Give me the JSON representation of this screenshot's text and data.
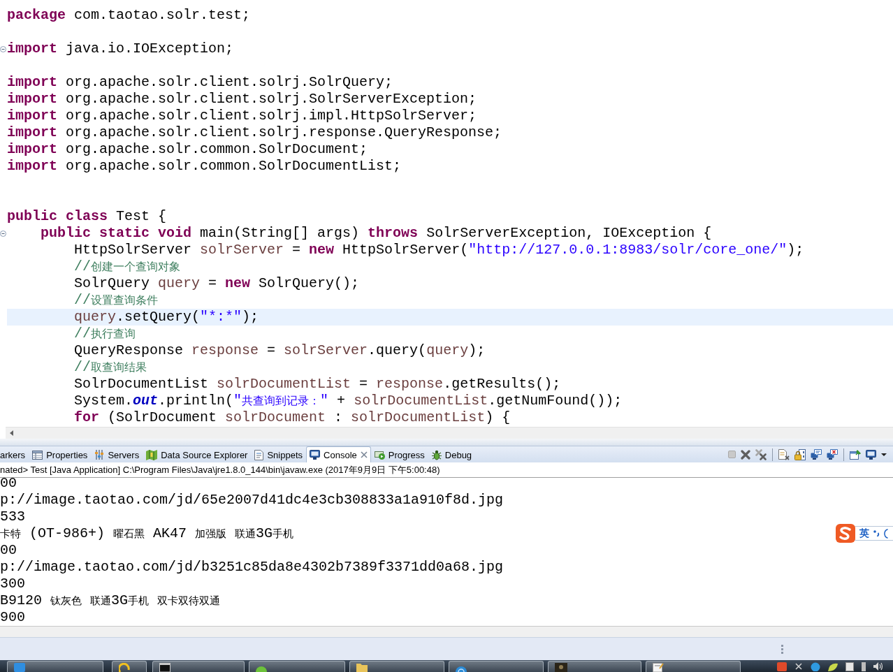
{
  "editor": {
    "lines": [
      {
        "kind": "code",
        "highlighted": false,
        "collapsible": false,
        "tokens": [
          {
            "kind": "keyword",
            "text": "package"
          },
          {
            "kind": "plain",
            "text": " com.taotao.solr.test;"
          }
        ]
      },
      {
        "kind": "blank"
      },
      {
        "kind": "code",
        "highlighted": false,
        "collapsible": true,
        "tokens": [
          {
            "kind": "keyword",
            "text": "import"
          },
          {
            "kind": "plain",
            "text": " java.io.IOException;"
          }
        ]
      },
      {
        "kind": "blank"
      },
      {
        "kind": "code",
        "highlighted": false,
        "collapsible": false,
        "tokens": [
          {
            "kind": "keyword",
            "text": "import"
          },
          {
            "kind": "plain",
            "text": " org.apache.solr.client.solrj.SolrQuery;"
          }
        ]
      },
      {
        "kind": "code",
        "highlighted": false,
        "collapsible": false,
        "tokens": [
          {
            "kind": "keyword",
            "text": "import"
          },
          {
            "kind": "plain",
            "text": " org.apache.solr.client.solrj.SolrServerException;"
          }
        ]
      },
      {
        "kind": "code",
        "highlighted": false,
        "collapsible": false,
        "tokens": [
          {
            "kind": "keyword",
            "text": "import"
          },
          {
            "kind": "plain",
            "text": " org.apache.solr.client.solrj.impl.HttpSolrServer;"
          }
        ]
      },
      {
        "kind": "code",
        "highlighted": false,
        "collapsible": false,
        "tokens": [
          {
            "kind": "keyword",
            "text": "import"
          },
          {
            "kind": "plain",
            "text": " org.apache.solr.client.solrj.response.QueryResponse;"
          }
        ]
      },
      {
        "kind": "code",
        "highlighted": false,
        "collapsible": false,
        "tokens": [
          {
            "kind": "keyword",
            "text": "import"
          },
          {
            "kind": "plain",
            "text": " org.apache.solr.common.SolrDocument;"
          }
        ]
      },
      {
        "kind": "code",
        "highlighted": false,
        "collapsible": false,
        "tokens": [
          {
            "kind": "keyword",
            "text": "import"
          },
          {
            "kind": "plain",
            "text": " org.apache.solr.common.SolrDocumentList;"
          }
        ]
      },
      {
        "kind": "blank"
      },
      {
        "kind": "blank"
      },
      {
        "kind": "code",
        "highlighted": false,
        "collapsible": false,
        "tokens": [
          {
            "kind": "keyword",
            "text": "public"
          },
          {
            "kind": "keyword",
            "text": " class"
          },
          {
            "kind": "plain",
            "text": " Test {"
          }
        ]
      },
      {
        "kind": "code",
        "highlighted": false,
        "collapsible": true,
        "tokens": [
          {
            "kind": "keyword",
            "text": "    public"
          },
          {
            "kind": "keyword",
            "text": " static"
          },
          {
            "kind": "keyword",
            "text": " void"
          },
          {
            "kind": "plain",
            "text": " main(String[] args) "
          },
          {
            "kind": "keyword",
            "text": "throws"
          },
          {
            "kind": "plain",
            "text": " SolrServerException, IOException {"
          }
        ]
      },
      {
        "kind": "code",
        "highlighted": false,
        "collapsible": false,
        "tokens": [
          {
            "kind": "plain",
            "text": "        HttpSolrServer "
          },
          {
            "kind": "variable",
            "text": "solrServer"
          },
          {
            "kind": "plain",
            "text": " = "
          },
          {
            "kind": "keyword",
            "text": "new"
          },
          {
            "kind": "plain",
            "text": " HttpSolrServer("
          },
          {
            "kind": "string",
            "text": "\"http://127.0.0.1:8983/solr/core_one/\""
          },
          {
            "kind": "plain",
            "text": ");"
          }
        ]
      },
      {
        "kind": "code",
        "highlighted": false,
        "collapsible": false,
        "tokens": [
          {
            "kind": "comment",
            "text": "        //创建一个查询对象"
          }
        ]
      },
      {
        "kind": "code",
        "highlighted": false,
        "collapsible": false,
        "tokens": [
          {
            "kind": "plain",
            "text": "        SolrQuery "
          },
          {
            "kind": "variable",
            "text": "query"
          },
          {
            "kind": "plain",
            "text": " = "
          },
          {
            "kind": "keyword",
            "text": "new"
          },
          {
            "kind": "plain",
            "text": " SolrQuery();"
          }
        ]
      },
      {
        "kind": "code",
        "highlighted": false,
        "collapsible": false,
        "tokens": [
          {
            "kind": "comment",
            "text": "        //设置查询条件"
          }
        ]
      },
      {
        "kind": "code",
        "highlighted": true,
        "collapsible": false,
        "tokens": [
          {
            "kind": "variable",
            "text": "        query"
          },
          {
            "kind": "plain",
            "text": ".setQuery("
          },
          {
            "kind": "string",
            "text": "\"*:*\""
          },
          {
            "kind": "plain",
            "text": ");"
          }
        ]
      },
      {
        "kind": "code",
        "highlighted": false,
        "collapsible": false,
        "tokens": [
          {
            "kind": "comment",
            "text": "        //执行查询"
          }
        ]
      },
      {
        "kind": "code",
        "highlighted": false,
        "collapsible": false,
        "tokens": [
          {
            "kind": "plain",
            "text": "        QueryResponse "
          },
          {
            "kind": "variable",
            "text": "response"
          },
          {
            "kind": "plain",
            "text": " = "
          },
          {
            "kind": "variable",
            "text": "solrServer"
          },
          {
            "kind": "plain",
            "text": ".query("
          },
          {
            "kind": "variable",
            "text": "query"
          },
          {
            "kind": "plain",
            "text": ");"
          }
        ]
      },
      {
        "kind": "code",
        "highlighted": false,
        "collapsible": false,
        "tokens": [
          {
            "kind": "comment",
            "text": "        //取查询结果"
          }
        ]
      },
      {
        "kind": "code",
        "highlighted": false,
        "collapsible": false,
        "tokens": [
          {
            "kind": "plain",
            "text": "        SolrDocumentList "
          },
          {
            "kind": "variable",
            "text": "solrDocumentList"
          },
          {
            "kind": "plain",
            "text": " = "
          },
          {
            "kind": "variable",
            "text": "response"
          },
          {
            "kind": "plain",
            "text": ".getResults();"
          }
        ]
      },
      {
        "kind": "code",
        "highlighted": false,
        "collapsible": false,
        "tokens": [
          {
            "kind": "plain",
            "text": "        System."
          },
          {
            "kind": "field",
            "text": "out"
          },
          {
            "kind": "plain",
            "text": ".println("
          },
          {
            "kind": "string",
            "text": "\"共查询到记录：\""
          },
          {
            "kind": "plain",
            "text": " + "
          },
          {
            "kind": "variable",
            "text": "solrDocumentList"
          },
          {
            "kind": "plain",
            "text": ".getNumFound());"
          }
        ]
      },
      {
        "kind": "code",
        "highlighted": false,
        "collapsible": false,
        "tokens": [
          {
            "kind": "keyword",
            "text": "        for"
          },
          {
            "kind": "plain",
            "text": " (SolrDocument "
          },
          {
            "kind": "variable",
            "text": "solrDocument"
          },
          {
            "kind": "plain",
            "text": " : "
          },
          {
            "kind": "variable",
            "text": "solrDocumentList"
          },
          {
            "kind": "plain",
            "text": ") {"
          }
        ]
      }
    ]
  },
  "console_view": {
    "tabs": [
      {
        "label": "arkers",
        "selected": false
      },
      {
        "label": "Properties",
        "selected": false
      },
      {
        "label": "Servers",
        "selected": false
      },
      {
        "label": "Data Source Explorer",
        "selected": false
      },
      {
        "label": "Snippets",
        "selected": false
      },
      {
        "label": "Console",
        "selected": true
      },
      {
        "label": "Progress",
        "selected": false
      },
      {
        "label": "Debug",
        "selected": false
      }
    ],
    "toolbar": [
      {
        "kind": "terminate",
        "disabled": true
      },
      {
        "kind": "remove_launch",
        "disabled": false
      },
      {
        "kind": "remove_all",
        "disabled": false
      },
      {
        "kind": "separator"
      },
      {
        "kind": "clear",
        "disabled": false
      },
      {
        "kind": "scroll_lock",
        "disabled": false
      },
      {
        "kind": "show_on_output",
        "disabled": false
      },
      {
        "kind": "show_on_error",
        "disabled": false
      },
      {
        "kind": "separator"
      },
      {
        "kind": "pin",
        "disabled": false
      },
      {
        "kind": "display_console",
        "disabled": false
      },
      {
        "kind": "view_menu",
        "disabled": false
      }
    ],
    "process_label": "nated> Test [Java Application] C:\\Program Files\\Java\\jre1.8.0_144\\bin\\javaw.exe (2017年9月9日 下午5:00:48)",
    "output": [
      "00",
      "p://image.taotao.com/jd/65e2007d41dc4e3cb308833a1a910f8d.jpg",
      "533",
      "卡特 (OT-986+) 曜石黑 AK47 加强版 联通3G手机",
      "00",
      "p://image.taotao.com/jd/b3251c85da8e4302b7389f3371dd0a68.jpg",
      "300",
      "B9120 钛灰色 联通3G手机 双卡双待双通",
      "900"
    ]
  },
  "ime_toolbar": {
    "mode": "英"
  }
}
